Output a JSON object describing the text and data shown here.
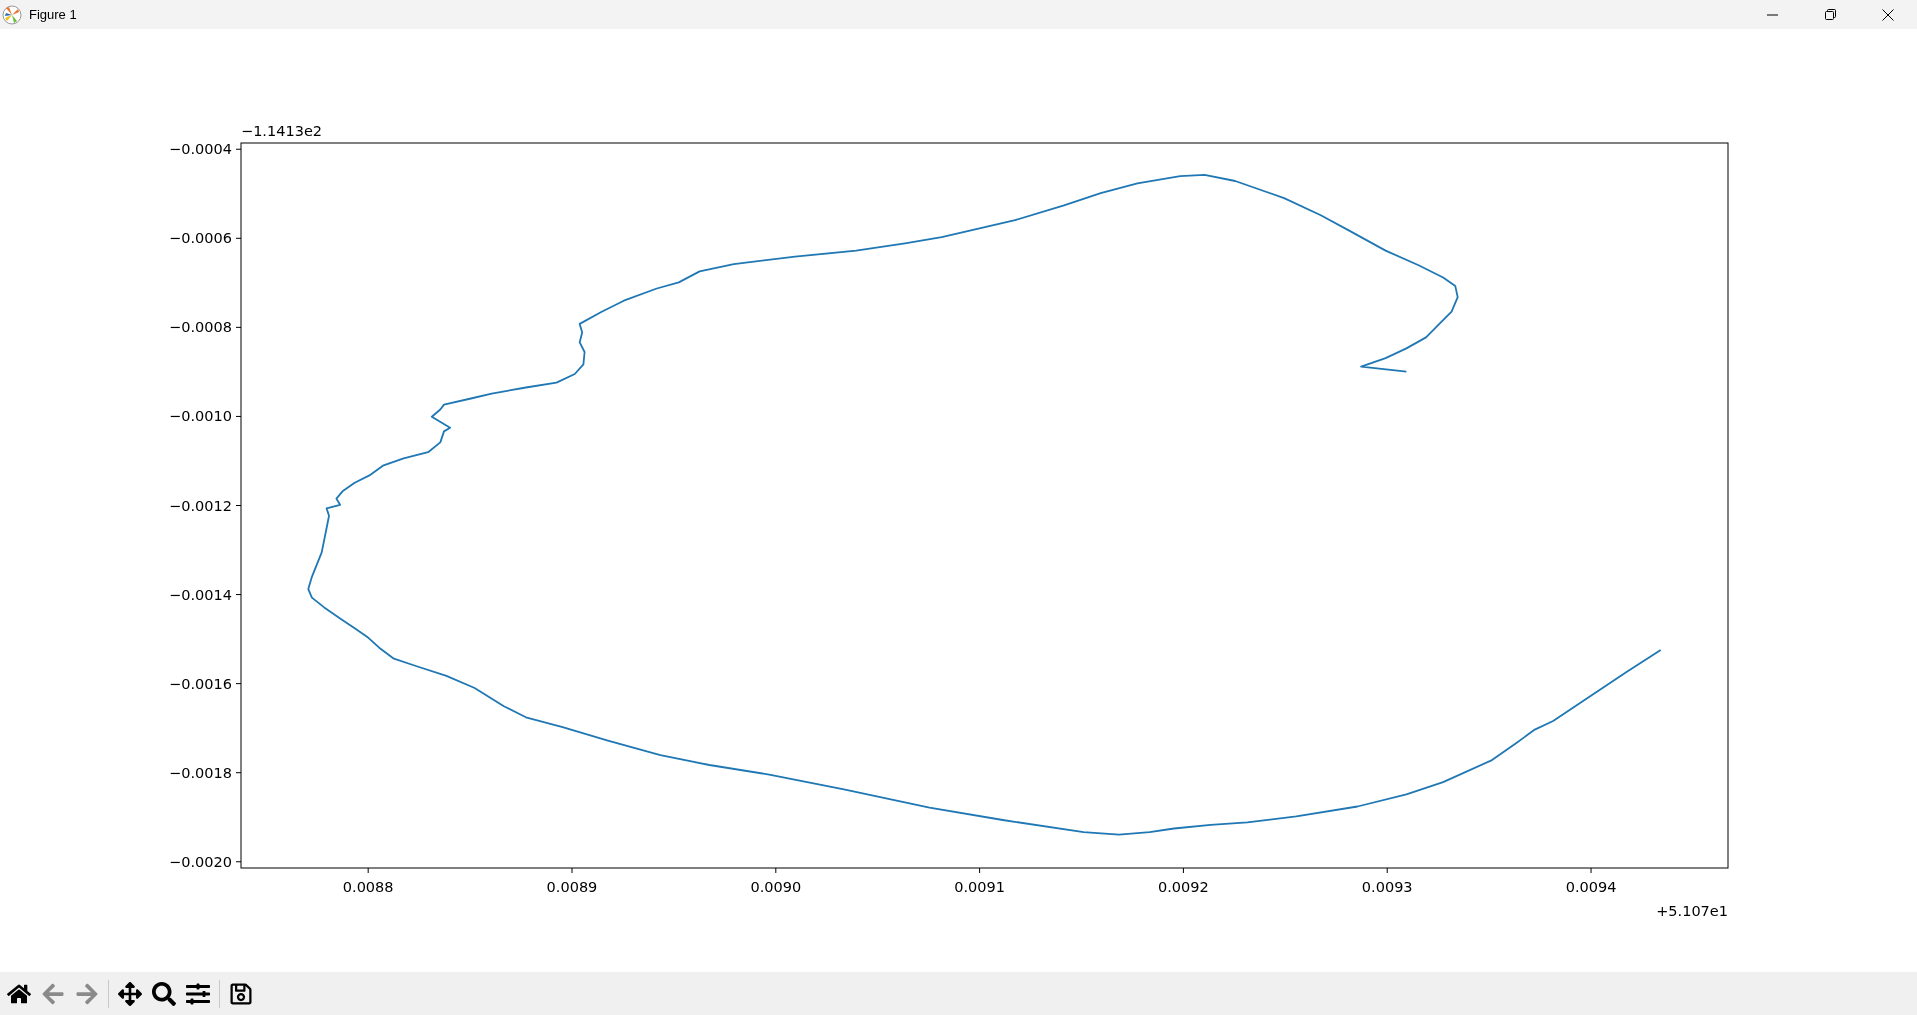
{
  "window": {
    "title": "Figure 1"
  },
  "figure": {
    "chart_data": {
      "type": "line",
      "xlim": [
        0.0087376,
        0.0094672
      ],
      "ylim": [
        -0.002014,
        -0.000386
      ],
      "xticks": [
        {
          "value": 0.0088,
          "label": "0.0088"
        },
        {
          "value": 0.0089,
          "label": "0.0089"
        },
        {
          "value": 0.009,
          "label": "0.0090"
        },
        {
          "value": 0.0091,
          "label": "0.0091"
        },
        {
          "value": 0.0092,
          "label": "0.0092"
        },
        {
          "value": 0.0093,
          "label": "0.0093"
        },
        {
          "value": 0.0094,
          "label": "0.0094"
        }
      ],
      "yticks": [
        {
          "value": -0.0004,
          "label": "−0.0004"
        },
        {
          "value": -0.0006,
          "label": "−0.0006"
        },
        {
          "value": -0.0008,
          "label": "−0.0008"
        },
        {
          "value": -0.001,
          "label": "−0.0010"
        },
        {
          "value": -0.0012,
          "label": "−0.0012"
        },
        {
          "value": -0.0014,
          "label": "−0.0014"
        },
        {
          "value": -0.0016,
          "label": "−0.0016"
        },
        {
          "value": -0.0018,
          "label": "−0.0018"
        },
        {
          "value": -0.002,
          "label": "−0.0020"
        }
      ],
      "x": [
        0.0093094,
        0.0092872,
        0.0092992,
        0.0093094,
        0.009319,
        0.0093262,
        0.0093316,
        0.0093346,
        0.0093334,
        0.0093274,
        0.0093154,
        0.0092992,
        0.0092818,
        0.0092674,
        0.0092494,
        0.0092254,
        0.0092104,
        0.0091984,
        0.0091774,
        0.0091594,
        0.0091414,
        0.0091174,
        0.0090994,
        0.0090814,
        0.0090634,
        0.0090394,
        0.0090094,
        0.0089794,
        0.0089626,
        0.0089524,
        0.0089416,
        0.0089254,
        0.0089146,
        0.0089038,
        0.008905,
        0.0089038,
        0.0089062,
        0.0089056,
        0.0089014,
        0.0088924,
        0.0088774,
        0.0088606,
        0.0088504,
        0.0088372,
        0.0088354,
        0.0088312,
        0.0088402,
        0.0088372,
        0.0088354,
        0.0088294,
        0.0088174,
        0.0088072,
        0.0088006,
        0.0087934,
        0.0087874,
        0.0087844,
        0.0087862,
        0.0087796,
        0.0087808,
        0.0087796,
        0.0087772,
        0.0087724,
        0.0087706,
        0.0087724,
        0.0087784,
        0.0087862,
        0.0087934,
        0.0087994,
        0.0088054,
        0.0088126,
        0.0088234,
        0.0088384,
        0.0088522,
        0.0088666,
        0.0088774,
        0.0088954,
        0.0089176,
        0.0089434,
        0.0089674,
        0.0089974,
        0.0090334,
        0.0090754,
        0.0091114,
        0.009151,
        0.0091684,
        0.0091834,
        0.0091954,
        0.0092134,
        0.0092314,
        0.0092554,
        0.0092854,
        0.0093094,
        0.0093274,
        0.0093514,
        0.0093634,
        0.0093724,
        0.0093814,
        0.0093994,
        0.0094174,
        0.0094342
      ],
      "series": [
        {
          "color": "#1f77b4",
          "values": [
            -0.0008993,
            -0.0008883,
            -0.0008691,
            -0.0008472,
            -0.0008225,
            -0.0007896,
            -0.0007649,
            -0.000732,
            -0.0007073,
            -0.0006881,
            -0.0006606,
            -0.0006277,
            -0.0005838,
            -0.0005481,
            -0.0005097,
            -0.0004713,
            -0.0004576,
            -0.0004604,
            -0.0004768,
            -0.0004988,
            -0.0005262,
            -0.0005591,
            -0.0005783,
            -0.0005975,
            -0.0006112,
            -0.0006277,
            -0.0006414,
            -0.0006579,
            -0.0006744,
            -0.000699,
            -0.0007128,
            -0.0007402,
            -0.0007649,
            -0.0007923,
            -0.0008115,
            -0.0008335,
            -0.0008554,
            -0.0008829,
            -0.0009048,
            -0.000924,
            -0.000935,
            -0.0009487,
            -0.0009597,
            -0.0009734,
            -0.0009844,
            -0.0010008,
            -0.0010255,
            -0.0010337,
            -0.0010584,
            -0.0010804,
            -0.0010941,
            -0.0011106,
            -0.0011325,
            -0.001149,
            -0.0011682,
            -0.0011846,
            -0.0011984,
            -0.0012066,
            -0.0012231,
            -0.0012505,
            -0.0013054,
            -0.0013602,
            -0.0013877,
            -0.0014069,
            -0.0014288,
            -0.0014535,
            -0.0014755,
            -0.0014947,
            -0.0015193,
            -0.001544,
            -0.0015605,
            -0.0015824,
            -0.0016099,
            -0.001651,
            -0.0016757,
            -0.0016977,
            -0.0017279,
            -0.0017608,
            -0.0017827,
            -0.0018047,
            -0.0018376,
            -0.0018787,
            -0.0019062,
            -0.0019336,
            -0.0019391,
            -0.0019336,
            -0.0019254,
            -0.0019172,
            -0.0019117,
            -0.001898,
            -0.001876,
            -0.0018486,
            -0.0018211,
            -0.0017718,
            -0.0017333,
            -0.0017032,
            -0.001684,
            -0.0016291,
            -0.0015742,
            -0.0015248
          ]
        }
      ]
    },
    "y_offset": "−1.1413e2",
    "x_offset": "+5.107e1"
  },
  "toolbar": [
    {
      "kind": "home",
      "disabled": false
    },
    {
      "kind": "back",
      "disabled": true
    },
    {
      "kind": "forward",
      "disabled": true
    },
    {
      "kind": "separator"
    },
    {
      "kind": "pan",
      "disabled": false
    },
    {
      "kind": "zoom",
      "disabled": false
    },
    {
      "kind": "configure",
      "disabled": false
    },
    {
      "kind": "separator"
    },
    {
      "kind": "save",
      "disabled": false
    }
  ]
}
